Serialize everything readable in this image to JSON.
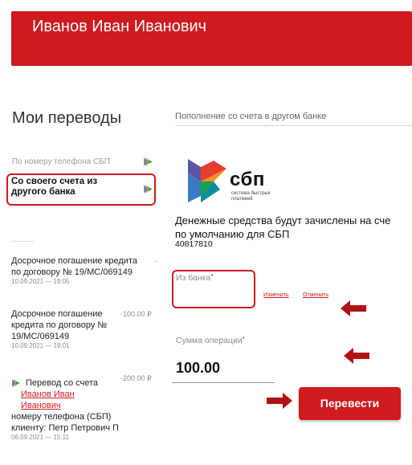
{
  "header": {
    "user_name": "Иванов Иван Иванович"
  },
  "sidebar": {
    "title": "Мои переводы",
    "nav": [
      {
        "label": "По номеру телефона СБП"
      },
      {
        "label": "Со своего счета из другого банка"
      }
    ],
    "history": [
      {
        "title": "Досрочное погашение кредита по договору № 19/MC/069149",
        "date": "10.09.2021 — 19:05",
        "amount": "-"
      },
      {
        "title": "Досрочное погашение кредита по договору № 19/MC/069149",
        "date": "10.09.2021 — 19:01",
        "amount": "-100.00 ₽"
      },
      {
        "title": "Перевод со счета",
        "link_name": "Иванов Иван Иванович",
        "details": "номеру телефона (СБП) клиенту: Петр Петрович П",
        "date": "06.09.2021 — 15:11",
        "amount": "-200.00 ₽"
      }
    ]
  },
  "main": {
    "tab": "Пополнение со счета в другом банке",
    "logo": {
      "text": "сбп",
      "subtitle_line1": "система быстрых",
      "subtitle_line2": "платежей"
    },
    "info_line1": "Денежные средства будут зачислены на сче",
    "info_line2": "по умолчанию для СБП",
    "account": "40817810",
    "from_bank": {
      "label": "Из банка",
      "change_link": "Изменить",
      "cancel_link": "Отменить"
    },
    "amount": {
      "label": "Сумма операции",
      "value": "100.00"
    },
    "submit_label": "Перевести"
  },
  "colors": {
    "brand_red": "#cf1a1f"
  },
  "icons": [
    "sbp-icon",
    "arrow-left-icon",
    "arrow-right-icon"
  ]
}
